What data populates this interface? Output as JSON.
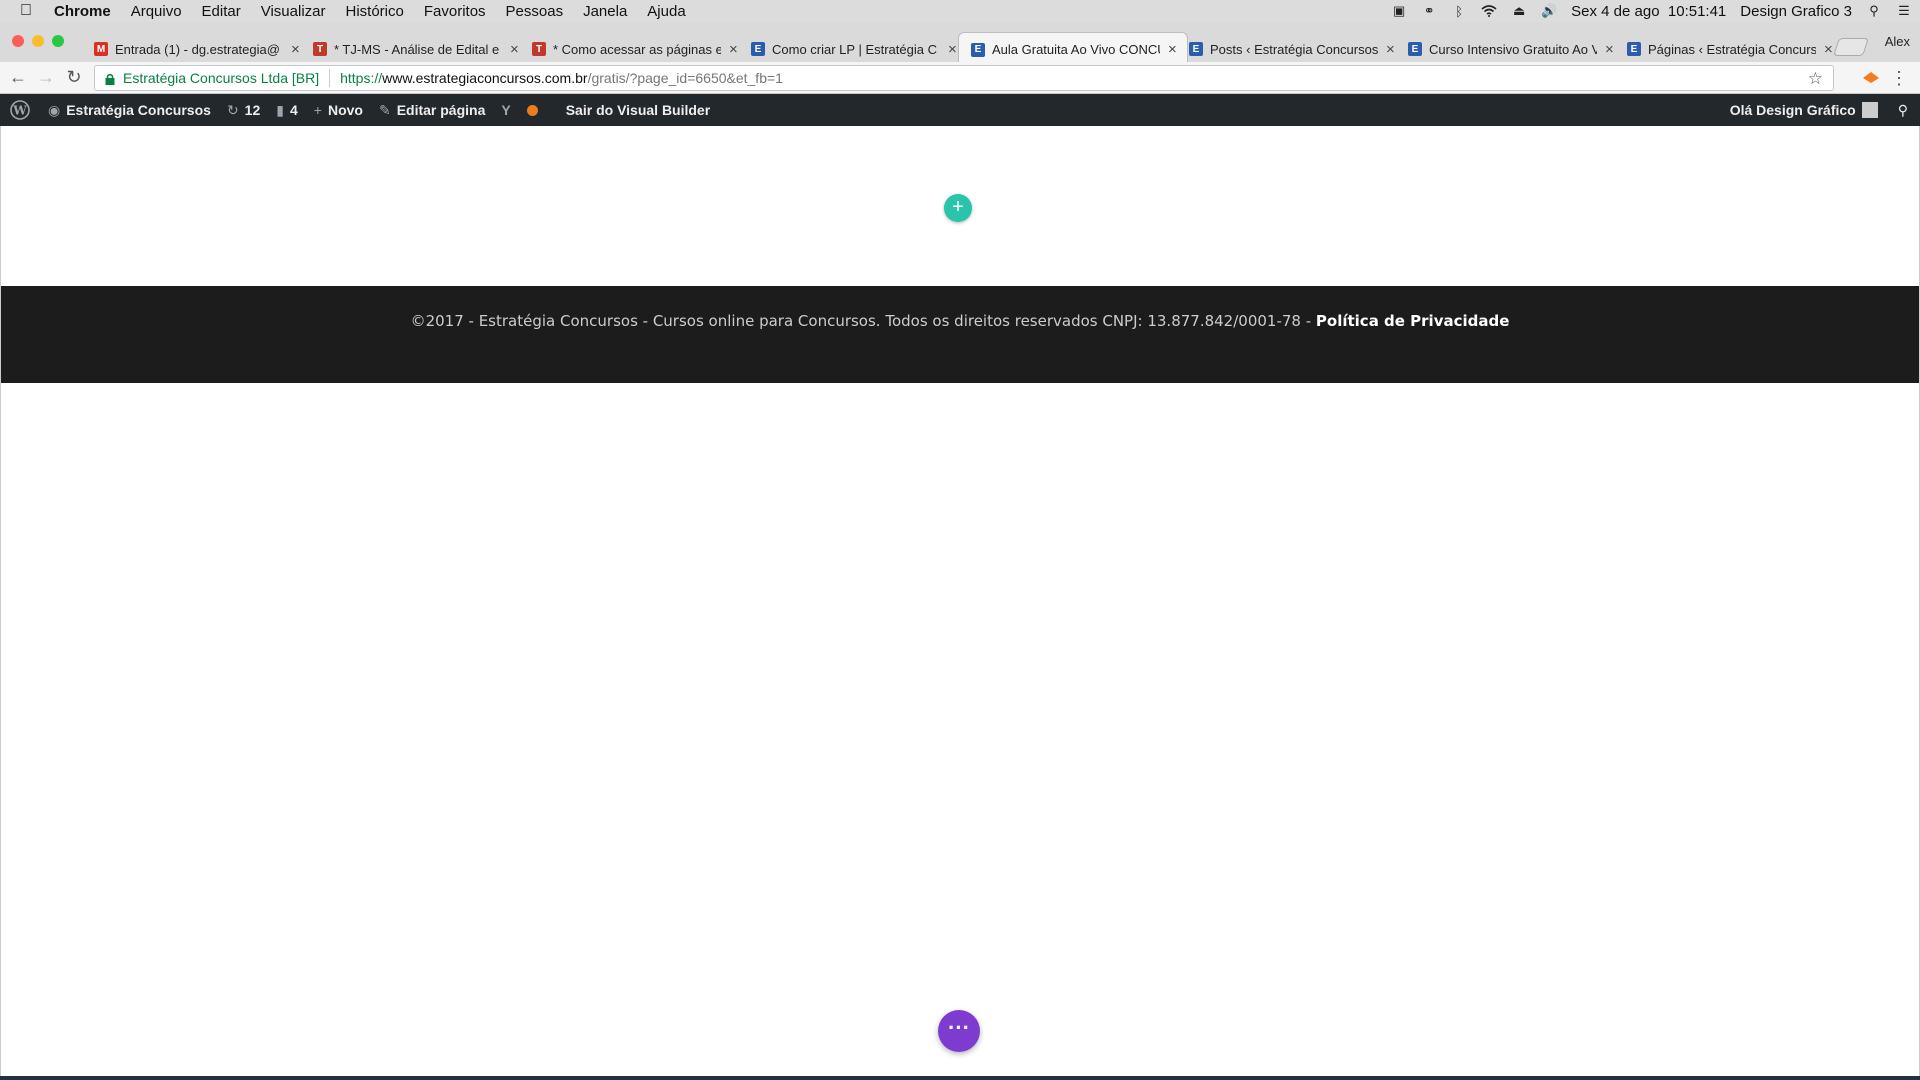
{
  "menubar": {
    "app_name": "Chrome",
    "items": [
      "Arquivo",
      "Editar",
      "Visualizar",
      "Histórico",
      "Favoritos",
      "Pessoas",
      "Janela",
      "Ajuda"
    ],
    "clock": "Sex 4 de ago  10:51:41",
    "user": "Design Grafico 3"
  },
  "tabs": [
    {
      "title": "Entrada (1) - dg.estrategia@",
      "icon": "gmail-icon",
      "color": "#d93025",
      "glyph": "M",
      "active": false
    },
    {
      "title": "* TJ-MS - Análise de Edital e",
      "icon": "trello-like-icon",
      "color": "#c0392b",
      "glyph": "T",
      "active": false
    },
    {
      "title": "* Como acessar as páginas e",
      "icon": "trello-like-icon",
      "color": "#c0392b",
      "glyph": "T",
      "active": false
    },
    {
      "title": "Como criar LP | Estratégia C",
      "icon": "wordpress-page-icon",
      "color": "#2b5cae",
      "glyph": "E",
      "active": false
    },
    {
      "title": "Aula Gratuita Ao Vivo CONCU",
      "icon": "wordpress-page-icon",
      "color": "#2b5cae",
      "glyph": "E",
      "active": true
    },
    {
      "title": "Posts ‹ Estratégia Concursos",
      "icon": "wordpress-page-icon",
      "color": "#2b5cae",
      "glyph": "E",
      "active": false
    },
    {
      "title": "Curso Intensivo Gratuito Ao V",
      "icon": "wordpress-page-icon",
      "color": "#2b5cae",
      "glyph": "E",
      "active": false
    },
    {
      "title": "Páginas ‹ Estratégia Concurs",
      "icon": "wordpress-page-icon",
      "color": "#2b5cae",
      "glyph": "E",
      "active": false
    }
  ],
  "profile_name": "Alex",
  "address": {
    "site_name": "Estratégia Concursos Ltda [BR]",
    "scheme": "https://",
    "host": "www.estrategiaconcursos.com.br",
    "path": "/gratis/?page_id=6650&et_fb=1"
  },
  "wpbar": {
    "site": "Estratégia Concursos",
    "updates": "12",
    "comments": "4",
    "new": "Novo",
    "edit": "Editar página",
    "exit_builder": "Sair do Visual Builder",
    "greeting": "Olá Design Gráfico"
  },
  "footer": {
    "text": "©2017 - Estratégia Concursos - Cursos online para Concursos. Todos os direitos reservados CNPJ: 13.877.842/0001-78 - ",
    "link": "Política de Privacidade"
  },
  "colors": {
    "add_button": "#29c4a9",
    "builder_menu": "#7e3bd0",
    "footer_bg": "#1c1c1c",
    "wp_bar_bg": "#23282d"
  }
}
